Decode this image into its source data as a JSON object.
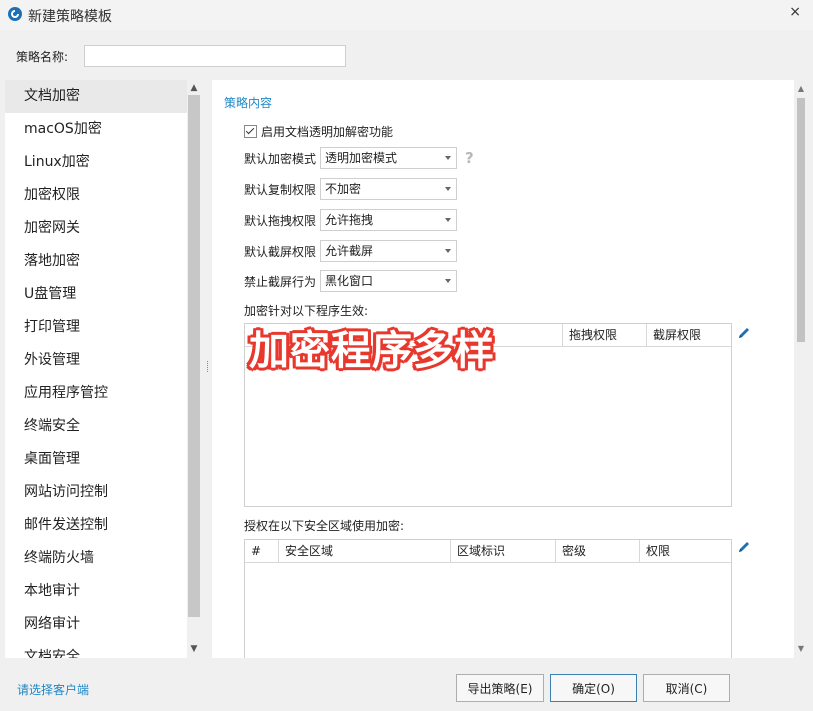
{
  "window": {
    "title": "新建策略模板",
    "close_glyph": "×"
  },
  "policy_name": {
    "label": "策略名称:",
    "value": ""
  },
  "sidebar": {
    "items": [
      {
        "label": "文档加密",
        "active": true
      },
      {
        "label": "macOS加密"
      },
      {
        "label": "Linux加密"
      },
      {
        "label": "加密权限"
      },
      {
        "label": "加密网关"
      },
      {
        "label": "落地加密"
      },
      {
        "label": "U盘管理"
      },
      {
        "label": "打印管理"
      },
      {
        "label": "外设管理"
      },
      {
        "label": "应用程序管控"
      },
      {
        "label": "终端安全"
      },
      {
        "label": "桌面管理"
      },
      {
        "label": "网站访问控制"
      },
      {
        "label": "邮件发送控制"
      },
      {
        "label": "终端防火墙"
      },
      {
        "label": "本地审计"
      },
      {
        "label": "网络审计"
      },
      {
        "label": "文档安全"
      }
    ]
  },
  "content": {
    "section_title": "策略内容",
    "enable_checkbox": {
      "label": "启用文档透明加解密功能",
      "checked": true
    },
    "fields": [
      {
        "label": "默认加密模式",
        "value": "透明加密模式",
        "help": "?"
      },
      {
        "label": "默认复制权限",
        "value": "不加密"
      },
      {
        "label": "默认拖拽权限",
        "value": "允许拖拽"
      },
      {
        "label": "默认截屏权限",
        "value": "允许截屏"
      },
      {
        "label": "禁止截屏行为",
        "value": "黑化窗口"
      }
    ],
    "programs_table": {
      "label": "加密针对以下程序生效:",
      "columns": [
        "",
        "拖拽权限",
        "截屏权限"
      ]
    },
    "zones_table": {
      "label": "授权在以下安全区域使用加密:",
      "columns": [
        "#",
        "安全区域",
        "区域标识",
        "密级",
        "权限"
      ]
    }
  },
  "overlay_caption": "加密程序多样",
  "footer": {
    "client_link": "请选择客户端",
    "export_button": "导出策略(E)",
    "ok_button": "确定(O)",
    "cancel_button": "取消(C)"
  },
  "colors": {
    "accent": "#1f87c6",
    "overlay_outline": "#e8382d",
    "edit_icon": "#1f6fb5"
  }
}
